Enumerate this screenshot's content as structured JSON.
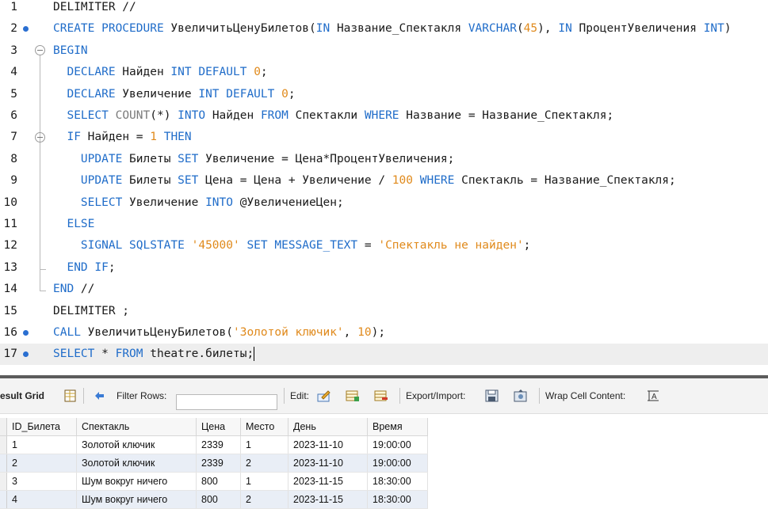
{
  "editor": {
    "lines": [
      {
        "n": "1",
        "dot": false,
        "tokens": [
          [
            "",
            "DELIMITER //"
          ]
        ]
      },
      {
        "n": "2",
        "dot": true,
        "tokens": [
          [
            "kw",
            "CREATE PROCEDURE"
          ],
          [
            "",
            " УвеличитьЦенуБилетов("
          ],
          [
            "kw",
            "IN"
          ],
          [
            "",
            " Название_Спектакля "
          ],
          [
            "kw",
            "VARCHAR"
          ],
          [
            "",
            "("
          ],
          [
            "num",
            "45"
          ],
          [
            "",
            "), "
          ],
          [
            "kw",
            "IN"
          ],
          [
            "",
            " ПроцентУвеличения "
          ],
          [
            "kw",
            "INT"
          ],
          [
            "",
            ")"
          ]
        ]
      },
      {
        "n": "3",
        "dot": false,
        "tokens": [
          [
            "kw",
            "BEGIN"
          ]
        ]
      },
      {
        "n": "4",
        "dot": false,
        "tokens": [
          [
            "",
            "  "
          ],
          [
            "kw",
            "DECLARE"
          ],
          [
            "",
            " Найден "
          ],
          [
            "kw",
            "INT DEFAULT"
          ],
          [
            "",
            " "
          ],
          [
            "num",
            "0"
          ],
          [
            "",
            ";"
          ]
        ]
      },
      {
        "n": "5",
        "dot": false,
        "tokens": [
          [
            "",
            "  "
          ],
          [
            "kw",
            "DECLARE"
          ],
          [
            "",
            " Увеличение "
          ],
          [
            "kw",
            "INT DEFAULT"
          ],
          [
            "",
            " "
          ],
          [
            "num",
            "0"
          ],
          [
            "",
            ";"
          ]
        ]
      },
      {
        "n": "6",
        "dot": false,
        "tokens": [
          [
            "",
            "  "
          ],
          [
            "kw",
            "SELECT"
          ],
          [
            "",
            " "
          ],
          [
            "fn",
            "COUNT"
          ],
          [
            "",
            "(*) "
          ],
          [
            "kw",
            "INTO"
          ],
          [
            "",
            " Найден "
          ],
          [
            "kw",
            "FROM"
          ],
          [
            "",
            " Спектакли "
          ],
          [
            "kw",
            "WHERE"
          ],
          [
            "",
            " Название = Название_Спектакля;"
          ]
        ]
      },
      {
        "n": "7",
        "dot": false,
        "tokens": [
          [
            "",
            "  "
          ],
          [
            "kw",
            "IF"
          ],
          [
            "",
            " Найден = "
          ],
          [
            "num",
            "1"
          ],
          [
            "",
            " "
          ],
          [
            "kw",
            "THEN"
          ]
        ]
      },
      {
        "n": "8",
        "dot": false,
        "tokens": [
          [
            "",
            "    "
          ],
          [
            "kw",
            "UPDATE"
          ],
          [
            "",
            " Билеты "
          ],
          [
            "kw",
            "SET"
          ],
          [
            "",
            " Увеличение = Цена*ПроцентУвеличения;"
          ]
        ]
      },
      {
        "n": "9",
        "dot": false,
        "tokens": [
          [
            "",
            "    "
          ],
          [
            "kw",
            "UPDATE"
          ],
          [
            "",
            " Билеты "
          ],
          [
            "kw",
            "SET"
          ],
          [
            "",
            " Цена = Цена + Увеличение / "
          ],
          [
            "num",
            "100"
          ],
          [
            "",
            " "
          ],
          [
            "kw",
            "WHERE"
          ],
          [
            "",
            " Спектакль = Название_Спектакля;"
          ]
        ]
      },
      {
        "n": "10",
        "dot": false,
        "tokens": [
          [
            "",
            "    "
          ],
          [
            "kw",
            "SELECT"
          ],
          [
            "",
            " Увеличение "
          ],
          [
            "kw",
            "INTO"
          ],
          [
            "",
            " @УвеличениеЦен;"
          ]
        ]
      },
      {
        "n": "11",
        "dot": false,
        "tokens": [
          [
            "",
            "  "
          ],
          [
            "kw",
            "ELSE"
          ]
        ]
      },
      {
        "n": "12",
        "dot": false,
        "tokens": [
          [
            "",
            "    "
          ],
          [
            "kw",
            "SIGNAL SQLSTATE"
          ],
          [
            "",
            " "
          ],
          [
            "str",
            "'45000'"
          ],
          [
            "",
            " "
          ],
          [
            "kw",
            "SET MESSAGE_TEXT"
          ],
          [
            "",
            " = "
          ],
          [
            "str",
            "'Спектакль не найден'"
          ],
          [
            "",
            ";"
          ]
        ]
      },
      {
        "n": "13",
        "dot": false,
        "tokens": [
          [
            "",
            "  "
          ],
          [
            "kw",
            "END IF"
          ],
          [
            "",
            ";"
          ]
        ]
      },
      {
        "n": "14",
        "dot": false,
        "tokens": [
          [
            "kw",
            "END"
          ],
          [
            "",
            " //"
          ]
        ]
      },
      {
        "n": "15",
        "dot": false,
        "tokens": [
          [
            "",
            "DELIMITER ;"
          ]
        ]
      },
      {
        "n": "16",
        "dot": true,
        "tokens": [
          [
            "kw",
            "CALL"
          ],
          [
            "",
            " УвеличитьЦенуБилетов("
          ],
          [
            "str",
            "'Золотой ключик'"
          ],
          [
            "",
            ", "
          ],
          [
            "num",
            "10"
          ],
          [
            "",
            ");"
          ]
        ]
      },
      {
        "n": "17",
        "dot": true,
        "current": true,
        "tokens": [
          [
            "kw",
            "SELECT"
          ],
          [
            "",
            " * "
          ],
          [
            "kw",
            "FROM"
          ],
          [
            "",
            " theatre.билеты;"
          ]
        ]
      }
    ]
  },
  "toolbar": {
    "result_grid_label": "esult Grid",
    "filter_rows_label": "Filter Rows:",
    "filter_rows_value": "",
    "edit_label": "Edit:",
    "export_import_label": "Export/Import:",
    "wrap_cell_label": "Wrap Cell Content:"
  },
  "grid": {
    "columns": [
      "ID_Билета",
      "Спектакль",
      "Цена",
      "Место",
      "День",
      "Время"
    ],
    "rows": [
      [
        "1",
        "Золотой ключик",
        "2339",
        "1",
        "2023-11-10",
        "19:00:00"
      ],
      [
        "2",
        "Золотой ключик",
        "2339",
        "2",
        "2023-11-10",
        "19:00:00"
      ],
      [
        "3",
        "Шум вокруг ничего",
        "800",
        "1",
        "2023-11-15",
        "18:30:00"
      ],
      [
        "4",
        "Шум вокруг ничего",
        "800",
        "2",
        "2023-11-15",
        "18:30:00"
      ]
    ]
  },
  "colors": {
    "keyword": "#1f6cc9",
    "string": "#e08a1c",
    "breakpoint_dot": "#2a6fd1",
    "alt_row": "#e9eef6"
  }
}
